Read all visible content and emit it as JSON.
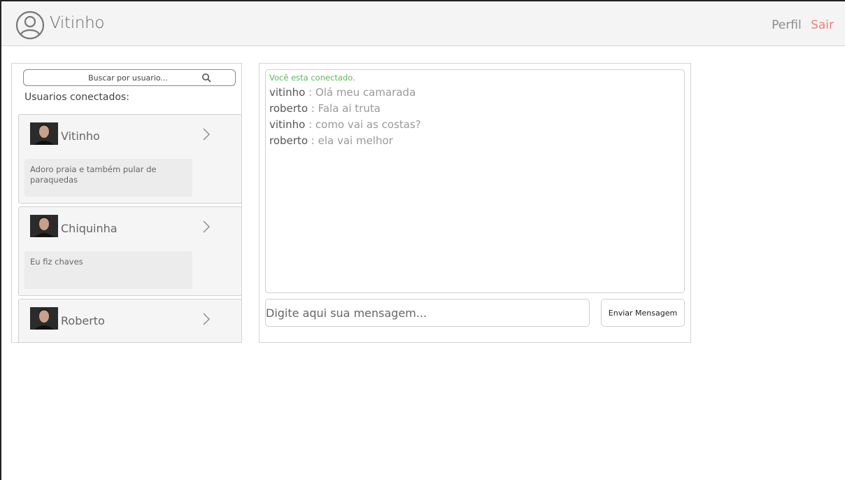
{
  "header": {
    "username": "Vitinho",
    "nav": {
      "profile": "Perfil",
      "logout": "Sair"
    }
  },
  "sidebar": {
    "search": {
      "placeholder": "Buscar por usuario..."
    },
    "online_title": "Usuarios conectados:",
    "users": [
      {
        "name": "Vitinho",
        "bio": "Adoro praia e também pular de paraquedas"
      },
      {
        "name": "Chiquinha",
        "bio": "Eu fiz chaves"
      },
      {
        "name": "Roberto",
        "bio": ""
      }
    ]
  },
  "chat": {
    "status": "Você esta conectado.",
    "messages": [
      {
        "author": "vitinho",
        "separator": " : ",
        "text": "Olá meu camarada"
      },
      {
        "author": "roberto",
        "separator": " : ",
        "text": "Fala ai truta"
      },
      {
        "author": "vitinho",
        "separator": " : ",
        "text": "como vai as costas?"
      },
      {
        "author": "roberto",
        "separator": " : ",
        "text": "ela vai melhor"
      }
    ],
    "composer": {
      "placeholder": "Digite aqui sua mensagem..."
    },
    "send_label": "Enviar Mensagem"
  },
  "colors": {
    "accent_logout": "#e88080",
    "status_green": "#5cb85c"
  }
}
